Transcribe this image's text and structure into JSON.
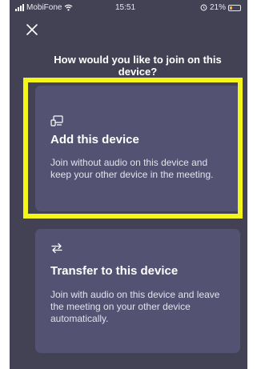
{
  "status_bar": {
    "carrier": "MobiFone",
    "time": "15:51",
    "battery_text": "21%",
    "battery_level": 0.21,
    "icons": [
      "signal-icon",
      "wifi-icon",
      "alarm-icon",
      "battery-icon"
    ]
  },
  "header": {
    "close_icon": "close-icon",
    "title": "How would you like to join on this device?"
  },
  "options": {
    "add": {
      "icon": "add-device-icon",
      "title": "Add this device",
      "description": "Join without audio on this device and keep your other device in the meeting."
    },
    "transfer": {
      "icon": "transfer-arrows-icon",
      "title": "Transfer to this device",
      "description": "Join with audio on this device and leave the meeting on your other device automatically."
    }
  },
  "colors": {
    "background": "#434255",
    "card": "#535272",
    "highlight": "#f5f519",
    "battery": "#f2b233"
  }
}
